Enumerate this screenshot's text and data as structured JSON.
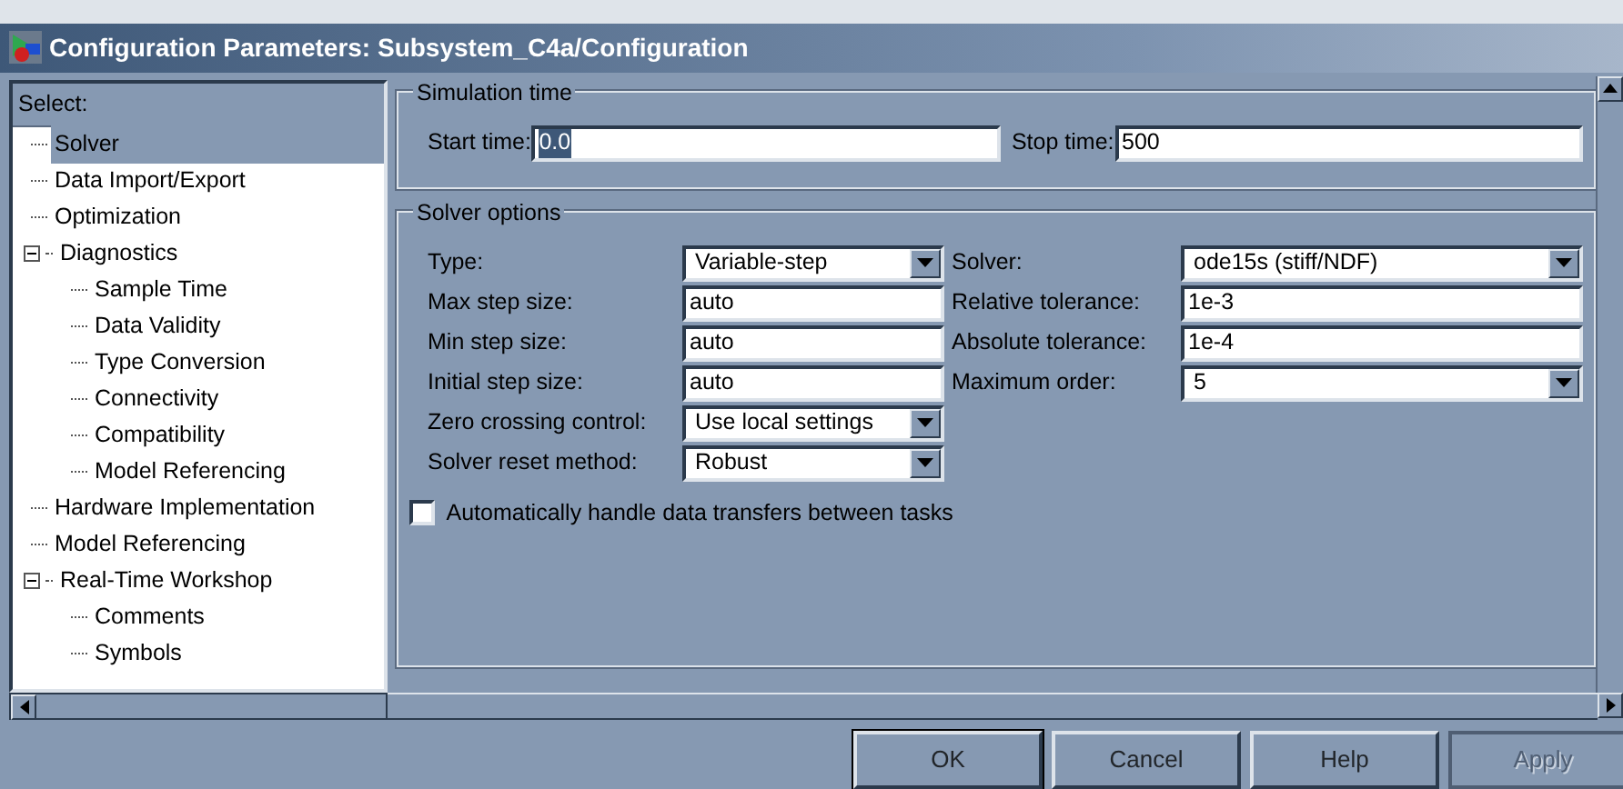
{
  "window": {
    "title": "Configuration Parameters: Subsystem_C4a/Configuration"
  },
  "tree": {
    "header": "Select:",
    "items": [
      {
        "label": "Solver",
        "selected": true
      },
      {
        "label": "Data Import/Export",
        "selected": false
      },
      {
        "label": "Optimization",
        "selected": false
      },
      {
        "label": "Diagnostics",
        "selected": false,
        "expanded": true,
        "children": [
          {
            "label": "Sample Time",
            "selected": false
          },
          {
            "label": "Data Validity",
            "selected": false
          },
          {
            "label": "Type Conversion",
            "selected": false
          },
          {
            "label": "Connectivity",
            "selected": false
          },
          {
            "label": "Compatibility",
            "selected": false
          },
          {
            "label": "Model Referencing",
            "selected": false
          }
        ]
      },
      {
        "label": "Hardware Implementation",
        "selected": false
      },
      {
        "label": "Model Referencing",
        "selected": false
      },
      {
        "label": "Real-Time Workshop",
        "selected": false,
        "expanded": true,
        "children": [
          {
            "label": "Comments",
            "selected": false
          },
          {
            "label": "Symbols",
            "selected": false
          }
        ]
      }
    ]
  },
  "simulation_time": {
    "title": "Simulation time",
    "fields": [
      {
        "label": "Start time:",
        "kind": "text",
        "value": "0.0",
        "highlighted": true
      },
      {
        "label": "Stop time:",
        "kind": "text",
        "value": "500",
        "highlighted": false
      }
    ]
  },
  "solver_options": {
    "title": "Solver options",
    "rows": [
      [
        {
          "label": "Type:",
          "kind": "select",
          "value": "Variable-step"
        },
        {
          "label": "Solver:",
          "kind": "select",
          "value": "ode15s (stiff/NDF)"
        }
      ],
      [
        {
          "label": "Max step size:",
          "kind": "text",
          "value": "auto"
        },
        {
          "label": "Relative tolerance:",
          "kind": "text",
          "value": "1e-3"
        }
      ],
      [
        {
          "label": "Min step size:",
          "kind": "text",
          "value": "auto"
        },
        {
          "label": "Absolute tolerance:",
          "kind": "text",
          "value": "1e-4"
        }
      ],
      [
        {
          "label": "Initial step size:",
          "kind": "text",
          "value": "auto"
        },
        {
          "label": "Maximum order:",
          "kind": "select",
          "value": "5"
        }
      ],
      [
        {
          "label": "Zero crossing control:",
          "kind": "select",
          "value": "Use local settings"
        }
      ],
      [
        {
          "label": "Solver reset method:",
          "kind": "select",
          "value": "Robust"
        }
      ]
    ],
    "checkbox": {
      "label": "Automatically handle data transfers between tasks",
      "checked": false
    }
  },
  "buttons": [
    {
      "label": "OK",
      "disabled": false,
      "default": true
    },
    {
      "label": "Cancel",
      "disabled": false,
      "default": false
    },
    {
      "label": "Help",
      "disabled": false,
      "default": false
    },
    {
      "label": "Apply",
      "disabled": true,
      "default": false
    }
  ]
}
